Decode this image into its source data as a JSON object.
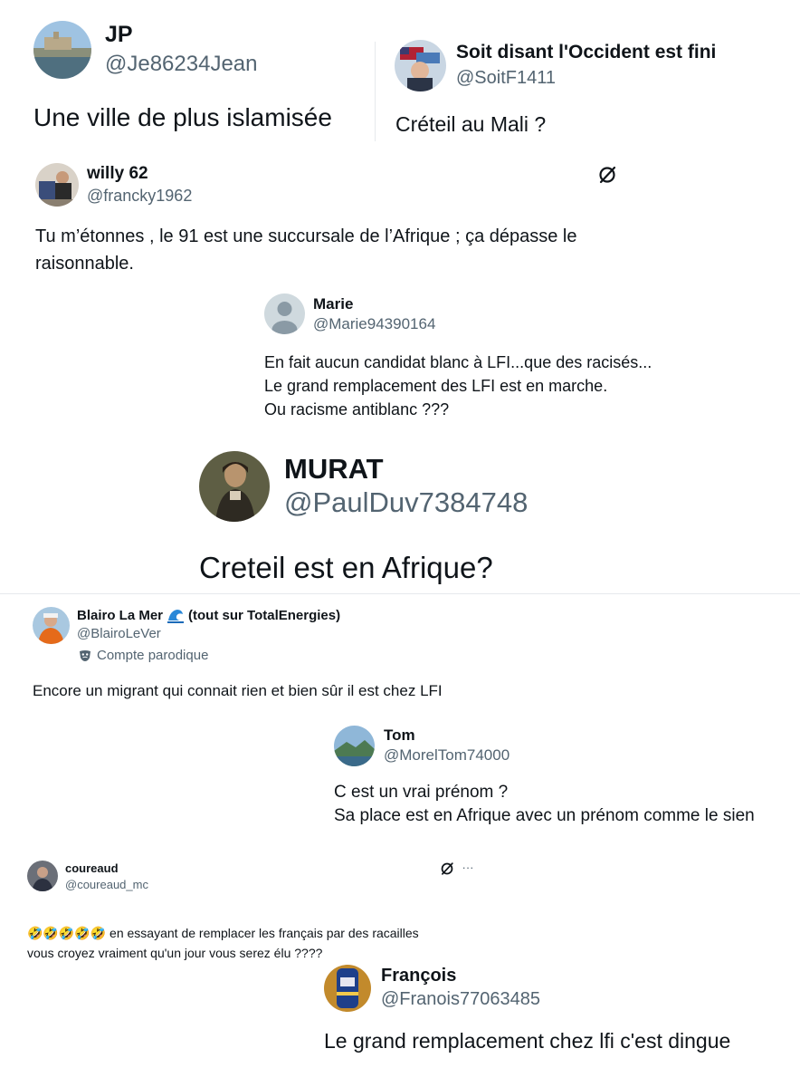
{
  "tweets": [
    {
      "name": "JP",
      "handle": "@Je86234Jean",
      "text": "Une ville de plus islamisée"
    },
    {
      "name": "Soit disant l'Occident est fini",
      "handle": "@SoitF1411",
      "text": "Créteil au Mali ?"
    },
    {
      "name": "willy 62",
      "handle": "@francky1962",
      "text": "Tu m’étonnes , le 91 est une succursale de l’Afrique ; ça dépasse le\nraisonnable."
    },
    {
      "name": "Marie",
      "handle": "@Marie94390164",
      "text": "En fait aucun candidat blanc à LFI...que des racisés...\nLe grand remplacement des LFI est en marche.\nOu      racisme antiblanc ???"
    },
    {
      "name": "MURAT",
      "handle": "@PaulDuv7384748",
      "text": "Creteil est en Afrique?"
    },
    {
      "name": "Blairo La Mer",
      "name_suffix": "(tout sur TotalEnergies)",
      "handle": "@BlairoLeVer",
      "badge": "Compte parodique",
      "text": "Encore un migrant qui connait rien et bien sûr il est chez LFI"
    },
    {
      "name": "Tom",
      "handle": "@MorelTom74000",
      "text": "C est un vrai prénom ?\nSa place est en Afrique avec un prénom comme le sien"
    },
    {
      "name": "coureaud",
      "handle": "@coureaud_mc",
      "emojis": "🤣🤣🤣🤣🤣",
      "text": " en essayant de remplacer les français par des racailles\nvous croyez vraiment qu'un jour vous serez élu ????"
    },
    {
      "name": "François",
      "handle": "@Franois77063485",
      "text": "Le grand remplacement chez lfi c'est dingue"
    }
  ],
  "icons": {
    "grok": "grok-icon",
    "more": "···",
    "wave": "wave-emoji",
    "mask": "theater-mask-icon"
  }
}
